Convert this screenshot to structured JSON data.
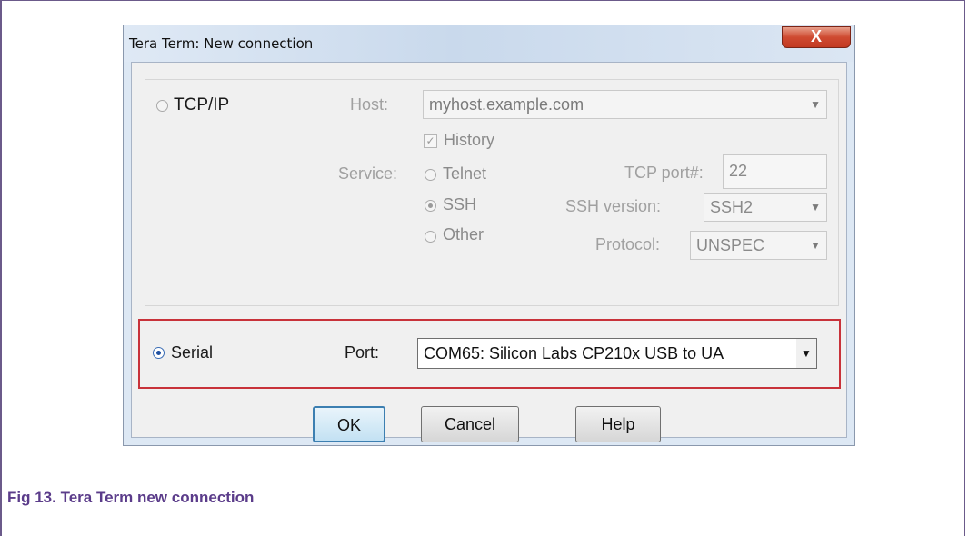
{
  "dialog": {
    "title": "Tera Term: New connection",
    "close_label": "X",
    "tcpip": {
      "label": "TCP/IP",
      "host_label": "Host:",
      "host_value": "myhost.example.com",
      "history_label": "History",
      "service_label": "Service:",
      "telnet_label": "Telnet",
      "ssh_label": "SSH",
      "other_label": "Other",
      "tcp_port_label": "TCP port#:",
      "tcp_port_value": "22",
      "ssh_version_label": "SSH version:",
      "ssh_version_value": "SSH2",
      "protocol_label": "Protocol:",
      "protocol_value": "UNSPEC"
    },
    "serial": {
      "label": "Serial",
      "port_label": "Port:",
      "port_value": "COM65: Silicon Labs CP210x USB to UA"
    },
    "buttons": {
      "ok": "OK",
      "cancel": "Cancel",
      "help": "Help"
    }
  },
  "caption": "Fig 13.  Tera Term new connection",
  "colors": {
    "caption": "#5b3c8a",
    "highlight_border": "#c8323a"
  },
  "icons": {
    "close": "close-icon",
    "dropdown": "chevron-down-icon"
  }
}
